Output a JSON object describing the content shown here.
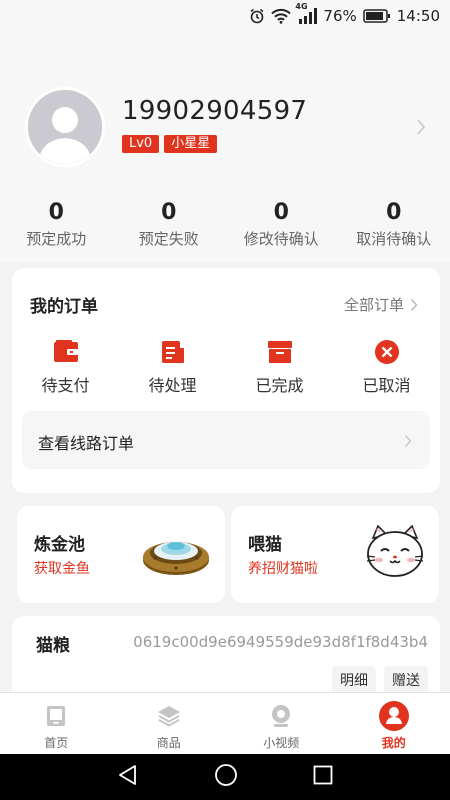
{
  "status_bar": {
    "network": "4G",
    "battery_percent": "76%",
    "time": "14:50",
    "icons": [
      "alarm-icon",
      "wifi-icon",
      "signal-icon",
      "battery-icon"
    ]
  },
  "profile": {
    "phone": "19902904597",
    "level_badge": "Lv0",
    "title_badge": "小星星"
  },
  "stats": [
    {
      "value": "0",
      "label": "预定成功"
    },
    {
      "value": "0",
      "label": "预定失败"
    },
    {
      "value": "0",
      "label": "修改待确认"
    },
    {
      "value": "0",
      "label": "取消待确认"
    }
  ],
  "orders": {
    "title": "我的订单",
    "all_label": "全部订单",
    "items": [
      {
        "label": "待支付",
        "icon": "wallet-icon"
      },
      {
        "label": "待处理",
        "icon": "document-icon"
      },
      {
        "label": "已完成",
        "icon": "box-icon"
      },
      {
        "label": "已取消",
        "icon": "cancel-icon"
      }
    ],
    "route_label": "查看线路订单"
  },
  "alchemy": {
    "title": "炼金池",
    "subtitle": "获取金鱼",
    "icon": "pool-icon"
  },
  "feed_cat": {
    "title": "喂猫",
    "subtitle": "养招财猫啦",
    "icon": "lucky-cat-icon"
  },
  "cat_food": {
    "label": "猫粮",
    "value": "0619c00d9e6949559de93d8f1f8d43b4",
    "details_label": "明细",
    "gift_label": "赠送"
  },
  "tabbar": [
    {
      "label": "首页",
      "icon": "home-icon",
      "active": false
    },
    {
      "label": "商品",
      "icon": "layers-icon",
      "active": false
    },
    {
      "label": "小视频",
      "icon": "video-icon",
      "active": false
    },
    {
      "label": "我的",
      "icon": "user-icon",
      "active": true
    }
  ],
  "colors": {
    "accent": "#e0341f",
    "background": "#f3f3f3",
    "card": "#ffffff"
  }
}
